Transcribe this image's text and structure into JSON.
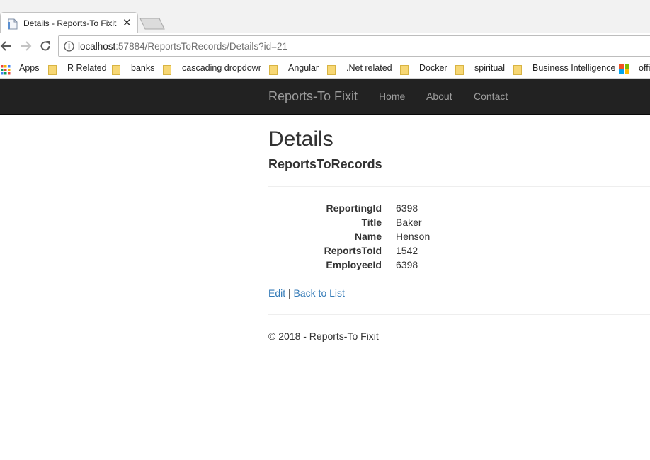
{
  "browser": {
    "tab": {
      "title": "Details - Reports-To Fixit",
      "close_glyph": "✕"
    },
    "address": {
      "host": "localhost",
      "rest": ":57884/ReportsToRecords/Details?id=21"
    },
    "bookmarks": [
      {
        "label": "Apps",
        "icon": "apps-grid-icon"
      },
      {
        "label": "R Related",
        "icon": "folder-icon"
      },
      {
        "label": "banks",
        "icon": "folder-icon"
      },
      {
        "label": "cascading dropdown",
        "icon": "folder-icon"
      },
      {
        "label": "Angular",
        "icon": "folder-icon"
      },
      {
        "label": ".Net related",
        "icon": "folder-icon"
      },
      {
        "label": "Docker",
        "icon": "folder-icon"
      },
      {
        "label": "spiritual",
        "icon": "folder-icon"
      },
      {
        "label": "Business Intelligence",
        "icon": "folder-icon"
      },
      {
        "label": "offi",
        "icon": "microsoft-logo-icon"
      }
    ]
  },
  "navbar": {
    "brand": "Reports-To Fixit",
    "links": [
      "Home",
      "About",
      "Contact"
    ]
  },
  "page": {
    "heading": "Details",
    "subheading": "ReportsToRecords",
    "fields": [
      {
        "label": "ReportingId",
        "value": "6398"
      },
      {
        "label": "Title",
        "value": "Baker"
      },
      {
        "label": "Name",
        "value": "Henson"
      },
      {
        "label": "ReportsToId",
        "value": "1542"
      },
      {
        "label": "EmployeeId",
        "value": "6398"
      }
    ],
    "edit_label": "Edit",
    "separator": "|",
    "back_label": "Back to List",
    "footer": "© 2018 - Reports-To Fixit"
  }
}
